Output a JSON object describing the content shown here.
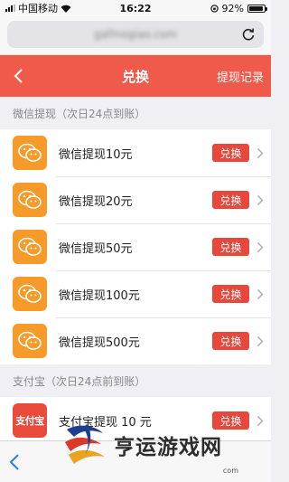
{
  "status": {
    "carrier": "中国移动",
    "time": "16:22",
    "battery": "92%",
    "battery_level": 0.92
  },
  "browser": {
    "url": "gafmsgiao.com"
  },
  "nav": {
    "title": "兑换",
    "right_link": "提现记录"
  },
  "wechat_section": {
    "header": "微信提现（次日24点到账）",
    "items": [
      {
        "label": "微信提现10元",
        "button": "兑换"
      },
      {
        "label": "微信提现20元",
        "button": "兑换"
      },
      {
        "label": "微信提现50元",
        "button": "兑换"
      },
      {
        "label": "微信提现100元",
        "button": "兑换"
      },
      {
        "label": "微信提现500元",
        "button": "兑换"
      }
    ]
  },
  "alipay_section": {
    "header": "支付宝（次日24点前到账）",
    "items": [
      {
        "label": "支付宝提现 10 元",
        "button": "兑换",
        "icon_text": "支付宝"
      }
    ]
  },
  "watermark": {
    "text": "亨运游戏网",
    "sub": "com"
  },
  "colors": {
    "brand_red": "#f05a4a",
    "button_red": "#e8473c",
    "wechat_orange": "#f69a2a"
  }
}
